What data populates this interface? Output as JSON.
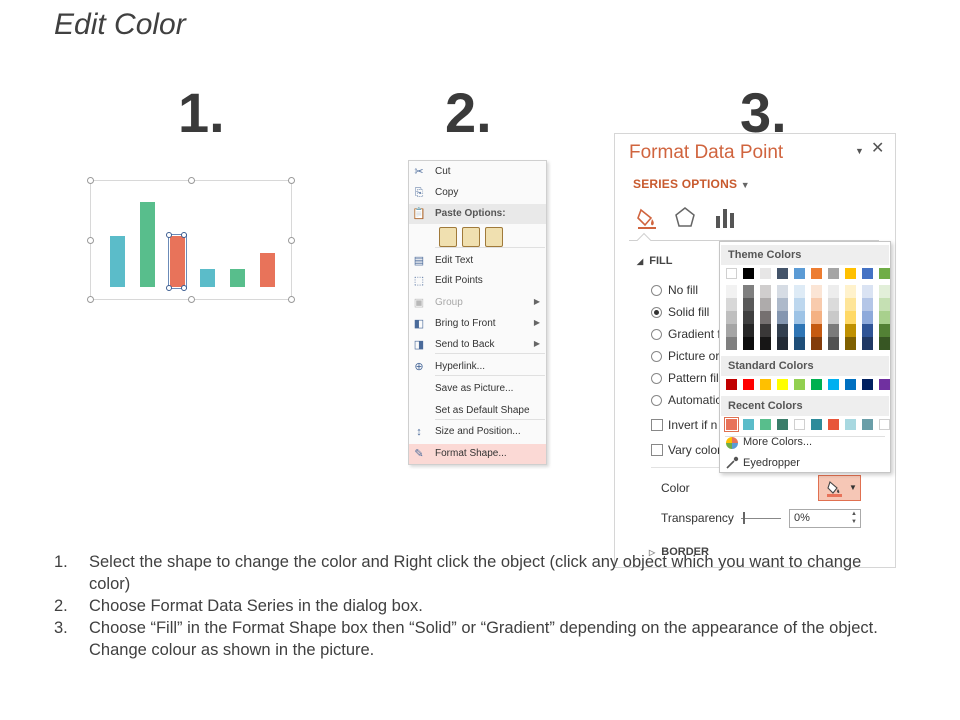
{
  "title": "Edit Color",
  "steps": [
    "1.",
    "2.",
    "3."
  ],
  "chart_data": {
    "type": "bar",
    "categories": [
      "",
      "",
      "",
      "",
      "",
      ""
    ],
    "values": [
      48,
      80,
      48,
      17,
      17,
      32
    ],
    "selected_index": 2,
    "colors": [
      "#5bbcc9",
      "#58be8c",
      "#e8735a",
      "#5bbcc9",
      "#58be8c",
      "#e8735a"
    ],
    "title": "",
    "xlabel": "",
    "ylabel": ""
  },
  "context_menu": {
    "items": [
      {
        "label": "Cut",
        "icon": "scissors-icon",
        "glyph": "✂",
        "disabled": false
      },
      {
        "label": "Copy",
        "icon": "copy-icon",
        "glyph": "⎘",
        "disabled": false
      },
      {
        "label": "Paste Options:",
        "icon": "paste-icon",
        "glyph": "📋",
        "header": true
      },
      {
        "label": "Edit Text",
        "icon": "edit-text-icon",
        "glyph": "▤",
        "disabled": false
      },
      {
        "label": "Edit Points",
        "icon": "edit-points-icon",
        "glyph": "⬚",
        "disabled": false
      },
      {
        "label": "Group",
        "icon": "group-icon",
        "glyph": "▣",
        "disabled": true,
        "submenu": true
      },
      {
        "label": "Bring to Front",
        "icon": "bring-front-icon",
        "glyph": "◧",
        "disabled": false,
        "submenu": true
      },
      {
        "label": "Send to Back",
        "icon": "send-back-icon",
        "glyph": "◨",
        "disabled": false,
        "submenu": true
      },
      {
        "label": "Hyperlink...",
        "icon": "hyperlink-icon",
        "glyph": "⊕",
        "disabled": false
      },
      {
        "label": "Save as Picture...",
        "icon": "",
        "glyph": "",
        "disabled": false
      },
      {
        "label": "Set as Default Shape",
        "icon": "",
        "glyph": "",
        "disabled": false
      },
      {
        "label": "Size and Position...",
        "icon": "size-position-icon",
        "glyph": "↕",
        "disabled": false
      },
      {
        "label": "Format Shape...",
        "icon": "format-shape-icon",
        "glyph": "✎",
        "disabled": false,
        "highlight": true
      }
    ]
  },
  "format_pane": {
    "title": "Format Data Point",
    "series_options": "SERIES OPTIONS",
    "fill_header": "FILL",
    "options": {
      "no_fill": "No fill",
      "solid_fill": "Solid fill",
      "gradient_fill": "Gradient f",
      "picture_fill": "Picture or",
      "pattern_fill": "Pattern fil",
      "automatic": "Automatic",
      "invert": "Invert if n",
      "vary": "Vary color"
    },
    "color_label": "Color",
    "transparency_label": "Transparency",
    "transparency_value": "0%",
    "border_header": "BORDER",
    "accent": "#d0643e"
  },
  "palette": {
    "theme_header": "Theme Colors",
    "standard_header": "Standard Colors",
    "recent_header": "Recent Colors",
    "theme_top": [
      "#ffffff",
      "#000000",
      "#e7e6e6",
      "#44546a",
      "#5b9bd5",
      "#ed7d31",
      "#a5a5a5",
      "#ffc000",
      "#4472c4",
      "#70ad47"
    ],
    "theme_shades": [
      [
        "#f2f2f2",
        "#7f7f7f",
        "#d0cece",
        "#d6dce4",
        "#deebf6",
        "#fbe5d5",
        "#ededed",
        "#fff2cc",
        "#dae3f3",
        "#e2efd9"
      ],
      [
        "#d8d8d8",
        "#595959",
        "#aeabab",
        "#adb9ca",
        "#bdd7ee",
        "#f8cbad",
        "#dbdbdb",
        "#fee599",
        "#b4c6e7",
        "#c5e0b3"
      ],
      [
        "#bfbfbf",
        "#3f3f3f",
        "#757070",
        "#8496b0",
        "#9dc3e6",
        "#f4b183",
        "#c9c9c9",
        "#ffd966",
        "#8eaadb",
        "#a8d08d"
      ],
      [
        "#a5a5a5",
        "#262626",
        "#3a3838",
        "#323f4f",
        "#2e75b5",
        "#c55a11",
        "#7b7b7b",
        "#bf9000",
        "#2f5496",
        "#538135"
      ],
      [
        "#7f7f7f",
        "#0c0c0c",
        "#171616",
        "#222a35",
        "#1e4e79",
        "#833c0b",
        "#525252",
        "#7f6000",
        "#1f3864",
        "#375623"
      ]
    ],
    "standard": [
      "#c00000",
      "#ff0000",
      "#ffc000",
      "#ffff00",
      "#92d050",
      "#00b050",
      "#00b0f0",
      "#0070c0",
      "#002060",
      "#7030a0"
    ],
    "recent": [
      "#e8735a",
      "#5bbcc9",
      "#58be8c",
      "#3a7d6a",
      "#ffffff",
      "#2e8b9a",
      "#e8553a",
      "#a8d8e0",
      "#6a9ea8",
      "#ffffff"
    ],
    "more_colors": "More Colors...",
    "eyedropper": "Eyedropper"
  },
  "instructions": [
    {
      "num": "1.",
      "text": "Select the shape to change the color and Right click the object (click any object which you want to change color)"
    },
    {
      "num": "2.",
      "text": "Choose Format Data Series in the dialog box."
    },
    {
      "num": "3.",
      "text": "Choose “Fill” in the Format Shape box then “Solid” or “Gradient” depending on the appearance of the object. Change colour as shown in the picture."
    }
  ]
}
